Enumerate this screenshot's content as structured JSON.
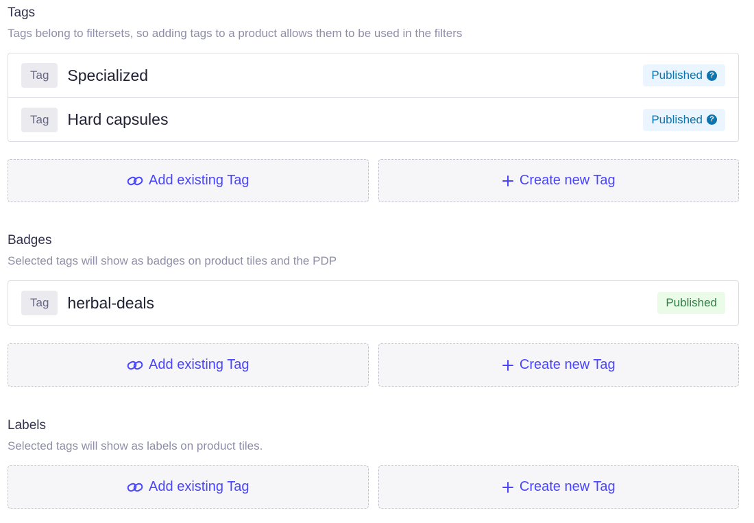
{
  "tags_section": {
    "title": "Tags",
    "description": "Tags belong to filtersets, so adding tags to a product allows them to be used in the filters",
    "items": [
      {
        "chip": "Tag",
        "name": "Specialized",
        "status": "Published",
        "status_color": "#0c75af"
      },
      {
        "chip": "Tag",
        "name": "Hard capsules",
        "status": "Published",
        "status_color": "#0c75af"
      }
    ],
    "add_existing_label": "Add existing Tag",
    "create_new_label": "Create new Tag"
  },
  "badges_section": {
    "title": "Badges",
    "description": "Selected tags will show as badges on product tiles and the PDP",
    "items": [
      {
        "chip": "Tag",
        "name": "herbal-deals",
        "status": "Published",
        "status_color": "#328048"
      }
    ],
    "add_existing_label": "Add existing Tag",
    "create_new_label": "Create new Tag"
  },
  "labels_section": {
    "title": "Labels",
    "description": "Selected tags will show as labels on product tiles.",
    "add_existing_label": "Add existing Tag",
    "create_new_label": "Create new Tag"
  },
  "icons": {
    "link": "link-icon",
    "plus": "plus-icon",
    "help": "question-mark-icon"
  },
  "colors": {
    "accent": "#4945ff",
    "border": "#dcdce4",
    "muted_text": "#8e8ea9"
  }
}
